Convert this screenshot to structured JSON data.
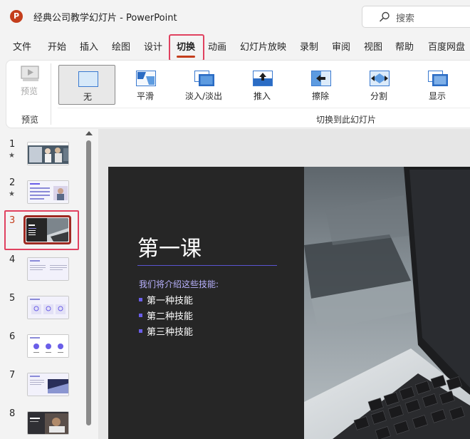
{
  "titlebar": {
    "app_logo": "P",
    "document_title": "经典公司教学幻灯片  -  PowerPoint",
    "search_placeholder": "搜索"
  },
  "menu_tabs": [
    {
      "label": "文件",
      "active": false
    },
    {
      "label": "开始",
      "active": false
    },
    {
      "label": "插入",
      "active": false
    },
    {
      "label": "绘图",
      "active": false
    },
    {
      "label": "设计",
      "active": false
    },
    {
      "label": "切换",
      "active": true
    },
    {
      "label": "动画",
      "active": false
    },
    {
      "label": "幻灯片放映",
      "active": false
    },
    {
      "label": "录制",
      "active": false
    },
    {
      "label": "审阅",
      "active": false
    },
    {
      "label": "视图",
      "active": false
    },
    {
      "label": "帮助",
      "active": false
    },
    {
      "label": "百度网盘",
      "active": false
    }
  ],
  "ribbon": {
    "preview_button": "预览",
    "group_preview_label": "预览",
    "group_transitions_label": "切换到此幻灯片",
    "transitions": [
      {
        "label": "无",
        "icon": "none-transition-icon",
        "selected": true
      },
      {
        "label": "平滑",
        "icon": "morph-transition-icon",
        "selected": false
      },
      {
        "label": "淡入/淡出",
        "icon": "fade-transition-icon",
        "selected": false
      },
      {
        "label": "推入",
        "icon": "push-transition-icon",
        "selected": false
      },
      {
        "label": "擦除",
        "icon": "wipe-transition-icon",
        "selected": false
      },
      {
        "label": "分割",
        "icon": "split-transition-icon",
        "selected": false
      },
      {
        "label": "显示",
        "icon": "reveal-transition-icon",
        "selected": false
      }
    ]
  },
  "slides": [
    {
      "number": "1",
      "star": "★",
      "selected": false
    },
    {
      "number": "2",
      "star": "★",
      "selected": false
    },
    {
      "number": "3",
      "star": "",
      "selected": true
    },
    {
      "number": "4",
      "star": "",
      "selected": false
    },
    {
      "number": "5",
      "star": "",
      "selected": false
    },
    {
      "number": "6",
      "star": "",
      "selected": false
    },
    {
      "number": "7",
      "star": "",
      "selected": false
    },
    {
      "number": "8",
      "star": "",
      "selected": false
    }
  ],
  "current_slide": {
    "title": "第一课",
    "intro": "我们将介绍这些技能:",
    "bullets": [
      "第一种技能",
      "第二种技能",
      "第三种技能"
    ]
  },
  "colors": {
    "accent": "#c43e1c",
    "highlight_outline": "#e0415f",
    "slide_background": "#262626",
    "slide_accent": "#6a5ee8"
  }
}
